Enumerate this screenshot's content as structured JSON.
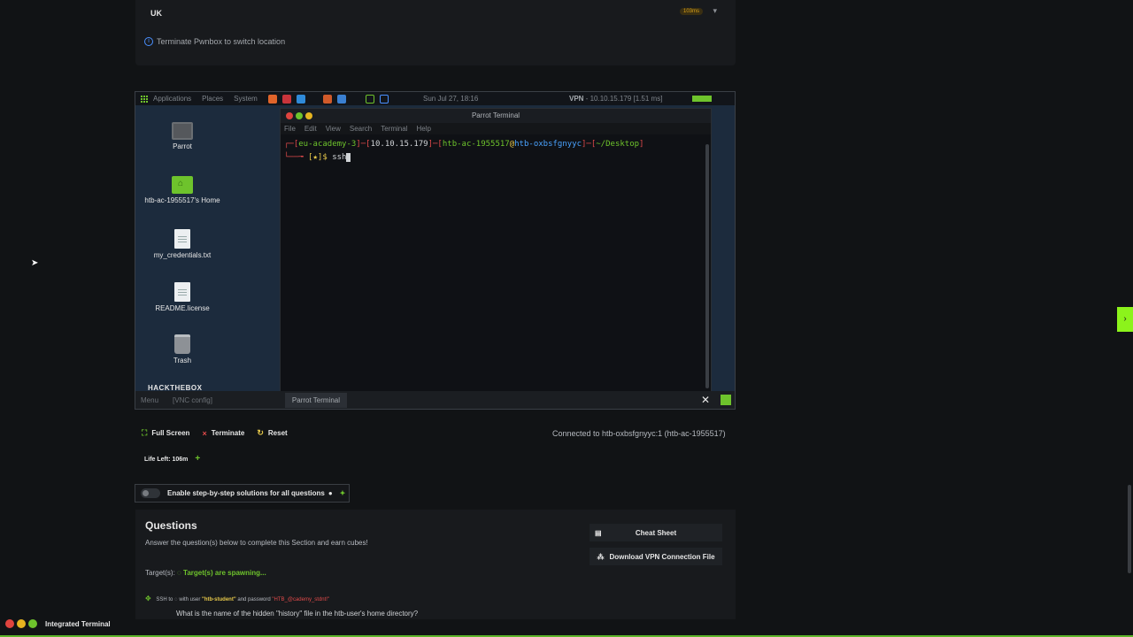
{
  "location": {
    "selected": "UK",
    "ping": "103ms",
    "info": "Terminate Pwnbox to switch location"
  },
  "vnc": {
    "topbar": {
      "menus": [
        "Applications",
        "Places",
        "System"
      ],
      "clock": "Sun Jul 27, 18:16",
      "vpn_label": "VPN",
      "vpn_value": "- 10.10.15.179 [1.51 ms]"
    },
    "desktop_icons": [
      "Parrot",
      "htb-ac-1955517's Home",
      "my_credentials.txt",
      "README.license",
      "Trash"
    ],
    "logo": "HACKTHEBOX",
    "terminal": {
      "title": "Parrot Terminal",
      "menu": [
        "File",
        "Edit",
        "View",
        "Search",
        "Terminal",
        "Help"
      ],
      "prompt_host": "eu-academy-3",
      "prompt_ip": "10.10.15.179",
      "prompt_user": "htb-ac-1955517",
      "prompt_machine": "htb-oxbsfgnyyc",
      "prompt_dir": "~/Desktop",
      "command": "ssh"
    },
    "taskbar": {
      "menu": "Menu",
      "config": "[VNC config]",
      "active": "Parrot Terminal"
    }
  },
  "controls": {
    "fullscreen": "Full Screen",
    "terminate": "Terminate",
    "reset": "Reset",
    "connected": "Connected to htb-oxbsfgnyyc:1 (htb-ac-1955517)",
    "life": "Life Left: 106m"
  },
  "toggle_label": "Enable step-by-step solutions for all questions",
  "questions": {
    "title": "Questions",
    "subtitle": "Answer the question(s) below to complete this Section and earn cubes!",
    "target_label": "Target(s):",
    "target_status": "Target(s) are spawning...",
    "ssh_prefix": "SSH to",
    "ssh_mid": "with user",
    "ssh_user": "\"htb-student\"",
    "ssh_pw_label": "and password",
    "ssh_pw": "\"HTB_@cademy_stdnt!\"",
    "next_question": "What is the name of the hidden \"history\" file in the htb-user's home directory?",
    "cheat_sheet": "Cheat Sheet",
    "download_vpn": "Download VPN Connection File"
  },
  "integrated_terminal": "Integrated Terminal",
  "colors": {
    "accent": "#6ec32c",
    "edge_tab": "#8cf31b",
    "background": "#111315"
  }
}
